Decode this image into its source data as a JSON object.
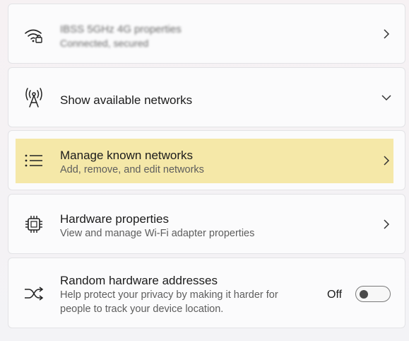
{
  "network_properties": {
    "title": "IBSS 5GHz 4G properties",
    "subtitle": "Connected, secured",
    "icon": "wifi-lock-icon"
  },
  "available_networks": {
    "title": "Show available networks",
    "icon": "antenna-icon"
  },
  "known_networks": {
    "title": "Manage known networks",
    "subtitle": "Add, remove, and edit networks",
    "icon": "list-icon",
    "highlight_color": "#f5e8a8"
  },
  "hardware_properties": {
    "title": "Hardware properties",
    "subtitle": "View and manage Wi-Fi adapter properties",
    "icon": "chip-icon"
  },
  "random_addresses": {
    "title": "Random hardware addresses",
    "subtitle_line1": "Help protect your privacy by making it harder for",
    "subtitle_line2": "people to track your device location.",
    "toggle_state": "Off",
    "icon": "shuffle-icon"
  }
}
